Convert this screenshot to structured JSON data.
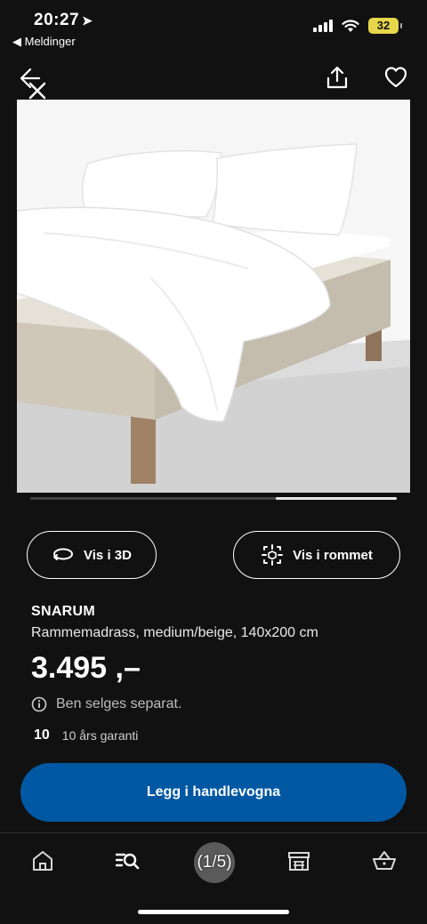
{
  "status": {
    "time": "20:27",
    "back_label": "◀ Meldinger",
    "battery": "32"
  },
  "product": {
    "image_alt": "SNARUM rammemadrass med hvitt sengetøy",
    "gallery_progress": 0.33,
    "brand": "SNARUM",
    "description": "Rammemadrass, medium/beige, 140x200 cm",
    "price": "3.495 ,–",
    "note": "Ben selges separat.",
    "warranty_years": "10",
    "warranty_text": "10 års garanti"
  },
  "actions": {
    "view_3d": "Vis i 3D",
    "view_room": "Vis i rommet",
    "add_to_cart": "Legg i handlevogna"
  },
  "tabbar": {
    "counter": "(1/5)",
    "items": [
      "home-icon",
      "search-icon",
      "store-icon",
      "basket-icon"
    ]
  },
  "colors": {
    "background": "#111111",
    "primary_button": "#0058a3",
    "battery": "#e6d64a"
  }
}
